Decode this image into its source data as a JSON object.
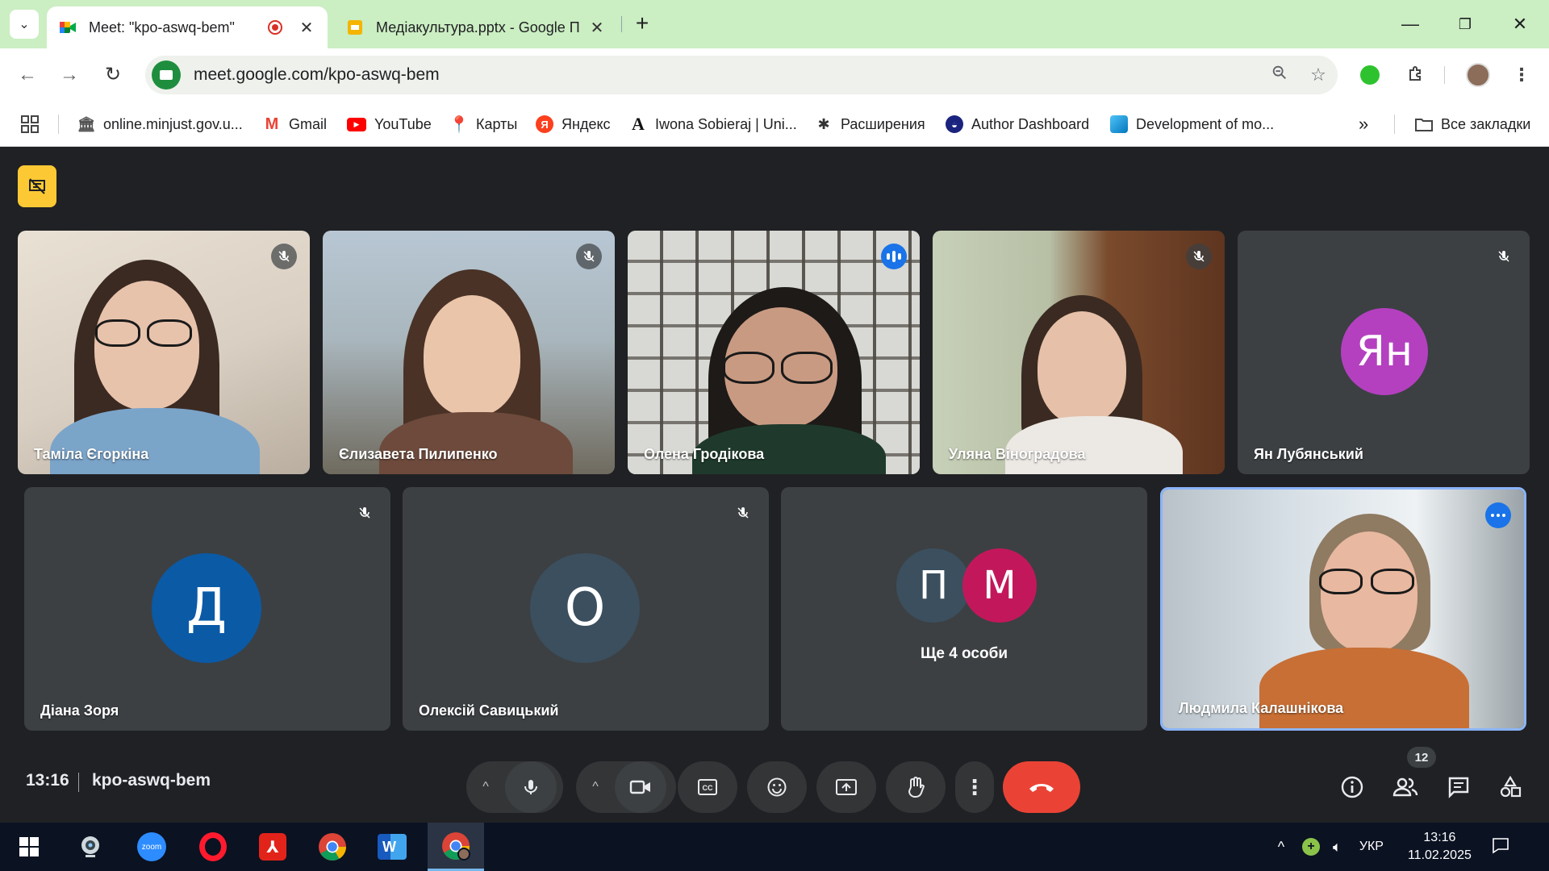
{
  "browser": {
    "tabs": [
      {
        "title": "Meet: \"kpo-aswq-bem\"",
        "active": true
      },
      {
        "title": "Медіакультура.pptx - Google П",
        "active": false
      }
    ],
    "url": "meet.google.com/kpo-aswq-bem",
    "window_controls": {
      "minimize": "—",
      "restore": "❐",
      "close": "✕"
    }
  },
  "bookmarks": {
    "items": [
      {
        "label": "online.minjust.gov.u...",
        "icon": "government-icon"
      },
      {
        "label": "Gmail",
        "icon": "gmail-icon"
      },
      {
        "label": "YouTube",
        "icon": "youtube-icon"
      },
      {
        "label": "Карты",
        "icon": "maps-icon"
      },
      {
        "label": "Яндекс",
        "icon": "yandex-icon"
      },
      {
        "label": "Iwona Sobieraj | Uni...",
        "icon": "academia-icon"
      },
      {
        "label": "Расширения",
        "icon": "extensions-icon"
      },
      {
        "label": "Author Dashboard",
        "icon": "author-dashboard-icon"
      },
      {
        "label": "Development of mo...",
        "icon": "development-icon"
      }
    ],
    "overflow": "»",
    "all_bookmarks": "Все закладки"
  },
  "meet": {
    "participants_row1": [
      {
        "name": "Таміла Єгоркіна",
        "muted": true
      },
      {
        "name": "Єлизавета Пилипенко",
        "muted": true
      },
      {
        "name": "Олена Гродікова",
        "muted": false,
        "speaking": true
      },
      {
        "name": "Уляна Віноградова",
        "muted": true
      },
      {
        "name": "Ян Лубянський",
        "muted": true,
        "initials": "Ян",
        "avatar_color": "#b440c0"
      }
    ],
    "participants_row2": [
      {
        "name": "Діана Зоря",
        "muted": true,
        "initials": "Д",
        "avatar_color": "#0b5aa6"
      },
      {
        "name": "Олексій Савицький",
        "muted": true,
        "initials": "О",
        "avatar_color": "#3b4f5e"
      },
      {
        "name": "Ще 4 особи",
        "initials_a": "П",
        "initials_b": "М",
        "color_a": "#3b4f5e",
        "color_b": "#c2185b"
      },
      {
        "name": "Людмила Калашнікова",
        "self": true
      }
    ],
    "time": "13:16",
    "meeting_code": "kpo-aswq-bem",
    "participant_count": "12"
  },
  "taskbar": {
    "language": "УКР",
    "time": "13:16",
    "date": "11.02.2025",
    "apps": [
      "windows-start-icon",
      "webcam-icon",
      "zoom-icon",
      "opera-icon",
      "acrobat-icon",
      "chrome-icon",
      "word-icon",
      "chrome-profile-icon"
    ],
    "zoom_label": "zoom"
  }
}
